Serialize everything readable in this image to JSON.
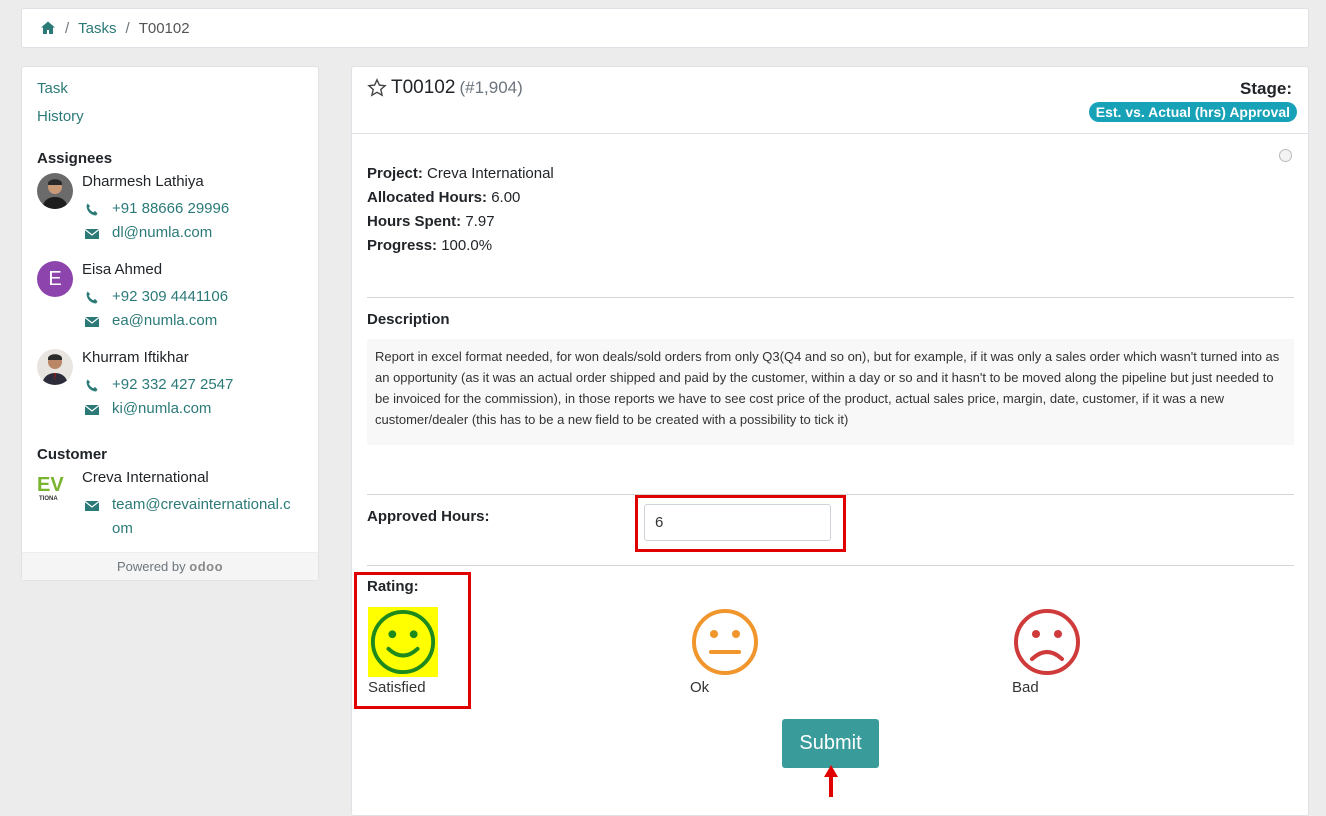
{
  "breadcrumb": {
    "home_icon": "home-icon",
    "items": [
      "Tasks",
      "T00102"
    ]
  },
  "sidebar": {
    "nav": [
      "Task",
      "History"
    ],
    "assignees_title": "Assignees",
    "assignees": [
      {
        "name": "Dharmesh Lathiya",
        "phone": "+91 88666 29996",
        "email": "dl@numla.com",
        "avatar": "photo"
      },
      {
        "name": "Eisa Ahmed",
        "phone": "+92 309 4441106",
        "email": "ea@numla.com",
        "avatar": "E"
      },
      {
        "name": "Khurram Iftikhar",
        "phone": "+92 332 427 2547",
        "email": "ki@numla.com",
        "avatar": "photo"
      }
    ],
    "customer_title": "Customer",
    "customer": {
      "name": "Creva International",
      "email": "team@crevainternational.com",
      "email_line1": "team@crevainternational.c",
      "email_line2": "om"
    },
    "powered_by": "Powered by",
    "powered_brand": "odoo"
  },
  "task": {
    "title": "T00102",
    "number": "(#1,904)",
    "stage_label": "Stage:",
    "stage": "Est. vs. Actual (hrs) Approval",
    "project_label": "Project:",
    "project": "Creva International",
    "allocated_label": "Allocated Hours:",
    "allocated": "6.00",
    "spent_label": "Hours Spent:",
    "spent": "7.97",
    "progress_label": "Progress:",
    "progress": "100.0%",
    "description_title": "Description",
    "description": "Report in excel format needed, for won deals/sold orders from only Q3(Q4 and so on), but for example, if it was only a sales order which wasn't turned into as an opportunity (as it was an actual order shipped and paid by the customer, within a day or so and it hasn't to be moved along the pipeline but just needed to be invoiced for the commission), in those reports we have to see cost price of the product, actual sales price, margin, date, customer, if it was a new customer/dealer (this has to be a new field to be created with a possibility to tick it)"
  },
  "form": {
    "approved_label": "Approved Hours:",
    "approved_value": "6",
    "rating_label": "Rating:",
    "ratings": [
      {
        "label": "Satisfied",
        "icon": "happy-face-icon",
        "color": "#1e8a1e",
        "selected": true
      },
      {
        "label": "Ok",
        "icon": "neutral-face-icon",
        "color": "#f0962d",
        "selected": false
      },
      {
        "label": "Bad",
        "icon": "sad-face-icon",
        "color": "#cf3b3b",
        "selected": false
      }
    ],
    "submit_label": "Submit"
  },
  "colors": {
    "accent": "#2b7a78",
    "badge": "#17a2b8",
    "submit": "#3a9b9b",
    "highlight": "#e00000",
    "selected_bg": "#ffff00"
  }
}
